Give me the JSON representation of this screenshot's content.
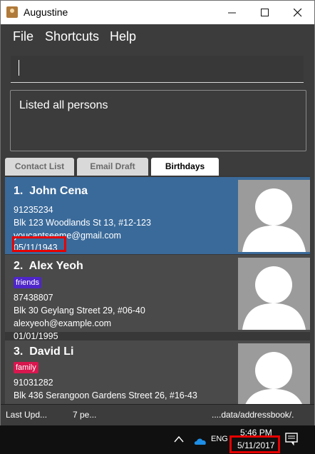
{
  "window": {
    "title": "Augustine"
  },
  "menu": {
    "file": "File",
    "shortcuts": "Shortcuts",
    "help": "Help"
  },
  "command_box": {
    "value": ""
  },
  "result_display": {
    "text": "Listed all persons"
  },
  "tabs": [
    {
      "label": "Contact List",
      "active": false
    },
    {
      "label": "Email Draft",
      "active": false
    },
    {
      "label": "Birthdays",
      "active": true
    }
  ],
  "persons": [
    {
      "index": "1.",
      "name": "John Cena",
      "phone": "91235234",
      "address": "Blk 123 Woodlands St 13, #12-123",
      "email": "youcantseeme@gmail.com",
      "birthday": "05/11/1943",
      "tags": [],
      "selected": true
    },
    {
      "index": "2.",
      "name": "Alex Yeoh",
      "tags": [
        {
          "label": "friends",
          "color": "#4f26c9"
        }
      ],
      "phone": "87438807",
      "address": "Blk 30 Geylang Street 29, #06-40",
      "email": "alexyeoh@example.com",
      "birthday": "01/01/1995",
      "selected": false
    },
    {
      "index": "3.",
      "name": "David Li",
      "tags": [
        {
          "label": "family",
          "color": "#d8174f"
        }
      ],
      "phone": "91031282",
      "address": "Blk 436 Serangoon Gardens Street 26, #16-43",
      "selected": false
    }
  ],
  "status_bar": {
    "last_updated": "Last Upd...",
    "person_count": "7 pe...",
    "save_location": "....data/addressbook/."
  },
  "taskbar": {
    "language": "ENG",
    "time": "5:46 PM",
    "date": "5/11/2017"
  },
  "colors": {
    "selected_card": "#3a6a9a",
    "card": "#4a4a4a",
    "app_bg": "#3c3c3c",
    "highlight": "#e60000"
  }
}
